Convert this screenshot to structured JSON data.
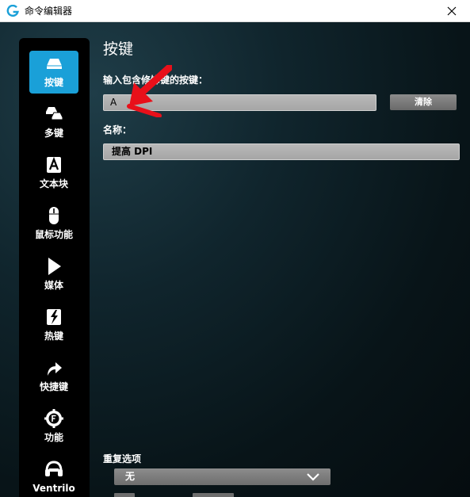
{
  "window": {
    "title": "命令编辑器"
  },
  "sidebar": {
    "items": [
      {
        "label": "按键",
        "icon": "keyboard-key-icon",
        "active": true
      },
      {
        "label": "多键",
        "icon": "multi-key-icon"
      },
      {
        "label": "文本块",
        "icon": "text-block-icon"
      },
      {
        "label": "鼠标功能",
        "icon": "mouse-icon"
      },
      {
        "label": "媒体",
        "icon": "media-play-icon"
      },
      {
        "label": "热键",
        "icon": "hotkey-icon"
      },
      {
        "label": "快捷键",
        "icon": "shortcut-arrow-icon"
      },
      {
        "label": "功能",
        "icon": "function-f-icon"
      },
      {
        "label": "Ventrilo",
        "icon": "ventrilo-headset-icon"
      }
    ]
  },
  "main": {
    "title": "按键",
    "keystroke_label": "输入包含修饰键的按键：",
    "keystroke_value": "A",
    "clear_label": "清除",
    "name_label": "名称：",
    "name_value": "提高 DPI",
    "repeat_label": "重复选项",
    "repeat_value": "无"
  },
  "colors": {
    "active": "#1aa0d8",
    "arrow": "#e8101a",
    "sidebar": "#000000"
  }
}
